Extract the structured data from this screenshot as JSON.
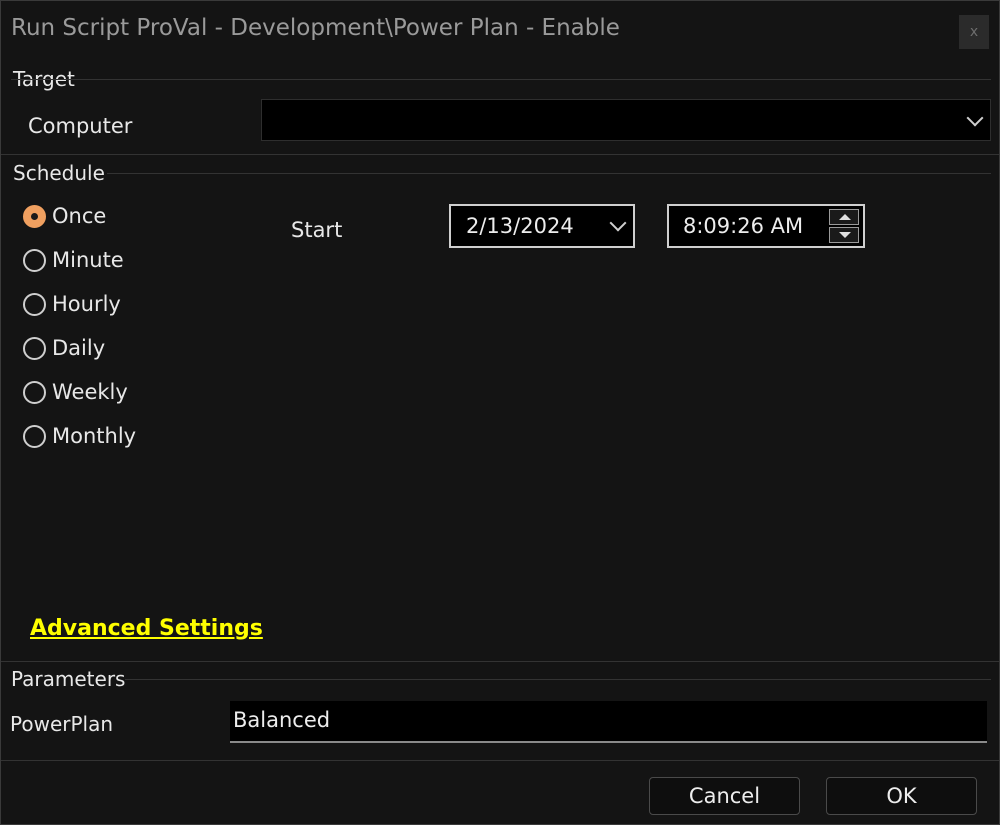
{
  "window": {
    "title": "Run Script ProVal - Development\\Power Plan - Enable",
    "close_glyph": "x"
  },
  "target": {
    "section_label": "Target",
    "computer_label": "Computer",
    "computer_value": ""
  },
  "schedule": {
    "section_label": "Schedule",
    "options": [
      {
        "label": "Once",
        "selected": true
      },
      {
        "label": "Minute",
        "selected": false
      },
      {
        "label": "Hourly",
        "selected": false
      },
      {
        "label": "Daily",
        "selected": false
      },
      {
        "label": "Weekly",
        "selected": false
      },
      {
        "label": "Monthly",
        "selected": false
      }
    ],
    "start_label": "Start",
    "start_date": "2/13/2024",
    "start_time": "8:09:26 AM",
    "advanced_link": "Advanced Settings"
  },
  "parameters": {
    "section_label": "Parameters",
    "powerplan_label": "PowerPlan",
    "powerplan_value": "Balanced"
  },
  "buttons": {
    "cancel": "Cancel",
    "ok": "OK"
  },
  "colors": {
    "background": "#141414",
    "accent_radio": "#f0a060",
    "link": "#ffff00"
  }
}
